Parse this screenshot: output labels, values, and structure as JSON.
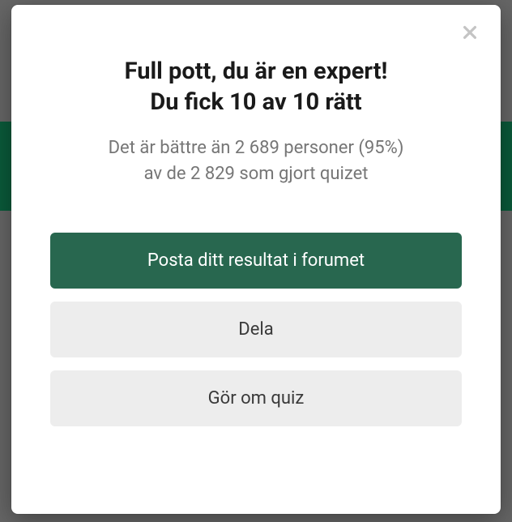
{
  "modal": {
    "heading_line1": "Full pott, du är en expert!",
    "heading_line2": "Du fick 10 av 10 rätt",
    "subtext_line1": "Det är bättre än 2 689 personer (95%)",
    "subtext_line2": "av de 2 829 som gjort quizet",
    "buttons": {
      "post_result": "Posta ditt resultat i forumet",
      "share": "Dela",
      "retry": "Gör om quiz"
    }
  }
}
